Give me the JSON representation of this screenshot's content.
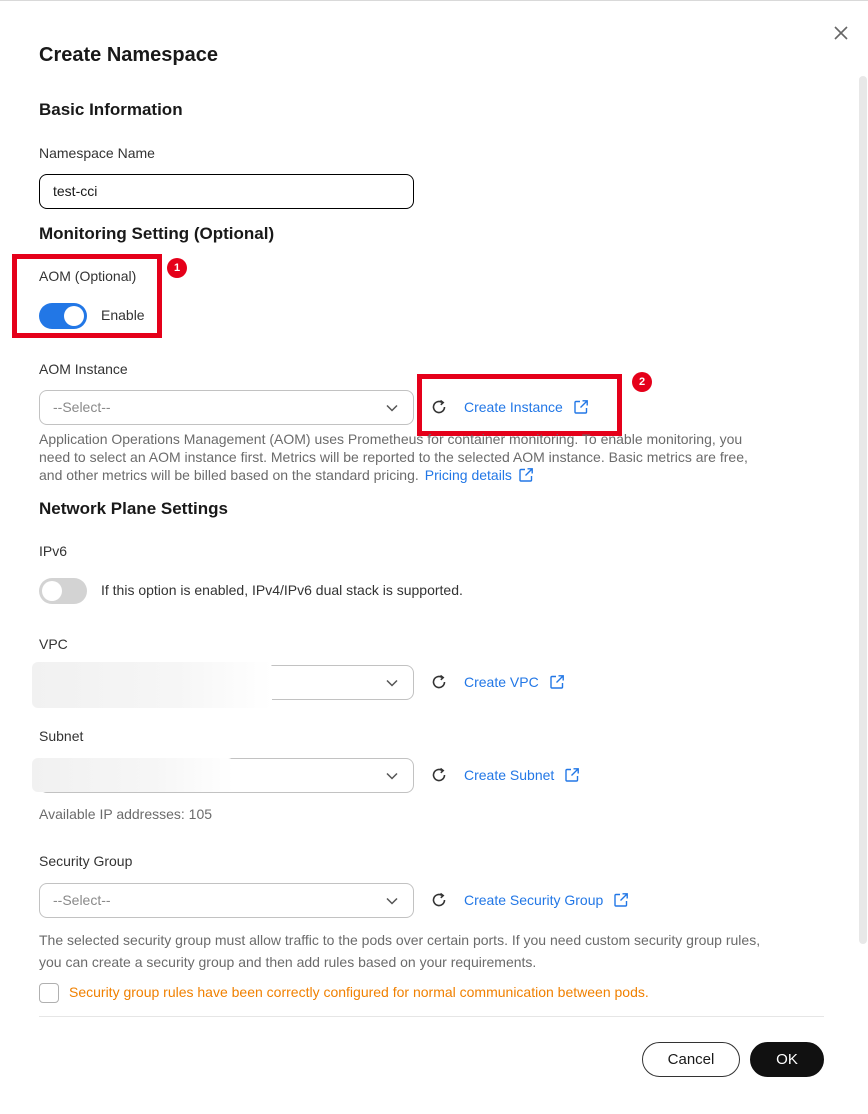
{
  "dialog": {
    "title": "Create Namespace",
    "close_icon": "close-icon"
  },
  "basic": {
    "heading": "Basic Information",
    "namespace_label": "Namespace Name",
    "namespace_value": "test-cci"
  },
  "monitoring": {
    "heading": "Monitoring Setting (Optional)",
    "aom_label": "AOM (Optional)",
    "aom_toggle_state": true,
    "aom_toggle_text": "Enable",
    "badge1": "1",
    "instance_label": "AOM Instance",
    "instance_select": "--Select--",
    "create_instance_link": "Create Instance",
    "badge2": "2",
    "help_line1": "Application Operations Management (AOM) uses Prometheus for container monitoring. To enable monitoring, you",
    "help_line2": "need to select an AOM instance first. Metrics will be reported to the selected AOM instance. Basic metrics are free,",
    "help_line3": "and other metrics will be billed based on the standard pricing.",
    "pricing_link": "Pricing details"
  },
  "network": {
    "heading": "Network Plane Settings",
    "ipv6_label": "IPv6",
    "ipv6_toggle_state": false,
    "ipv6_text": "If this option is enabled, IPv4/IPv6 dual stack is supported.",
    "vpc_label": "VPC",
    "create_vpc_link": "Create VPC",
    "subnet_label": "Subnet",
    "create_subnet_link": "Create Subnet",
    "available_ips": "Available IP addresses: 105",
    "sg_label": "Security Group",
    "sg_select": "--Select--",
    "create_sg_link": "Create Security Group",
    "sg_help_line1": "The selected security group must allow traffic to the pods over certain ports. If you need custom security group rules,",
    "sg_help_line2": "you can create a security group and then add rules based on your requirements.",
    "sg_confirm": "Security group rules have been correctly configured for normal communication between pods."
  },
  "footer": {
    "cancel": "Cancel",
    "ok": "OK"
  },
  "colors": {
    "accent": "#2277e6",
    "highlight_red": "#e5001a",
    "warning": "#f08000"
  }
}
